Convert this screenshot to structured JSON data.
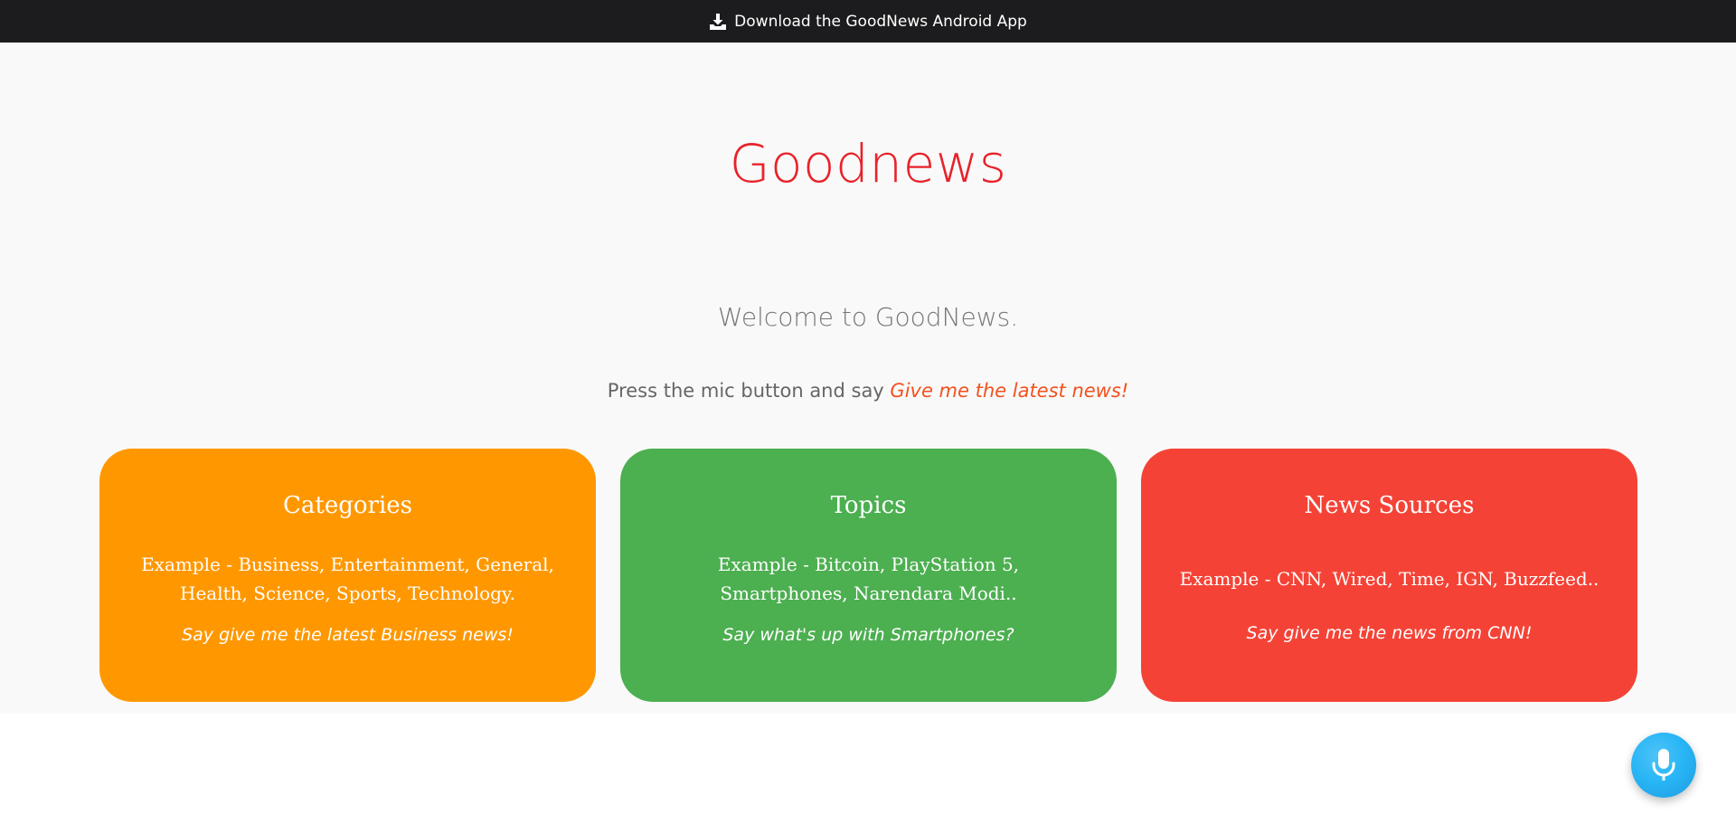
{
  "topbar": {
    "download_label": "Download the GoodNews Android App",
    "icon": "download-icon"
  },
  "header": {
    "logo_text": "Goodnews"
  },
  "intro": {
    "welcome": "Welcome to GoodNews.",
    "instruction_prefix": "Press the mic button and say ",
    "instruction_phrase": "Give me the latest news!"
  },
  "cards": [
    {
      "title": "Categories",
      "example": "Example - Business, Entertainment, General, Health, Science, Sports, Technology.",
      "hint": "Say give me the latest Business news!",
      "color": "#ff9800"
    },
    {
      "title": "Topics",
      "example": "Example - Bitcoin, PlayStation 5, Smartphones, Narendara Modi..",
      "hint": "Say what's up with Smartphones?",
      "color": "#4caf50"
    },
    {
      "title": "News Sources",
      "example": "Example - CNN, Wired, Time, IGN, Buzzfeed..",
      "hint": "Say give me the news from CNN!",
      "color": "#f44336"
    }
  ],
  "mic": {
    "icon": "microphone-icon",
    "color": "#29b6f6"
  },
  "colors": {
    "brand": "#e8222a",
    "accent_phrase": "#f4511e",
    "topbar": "#1c1c1e"
  }
}
